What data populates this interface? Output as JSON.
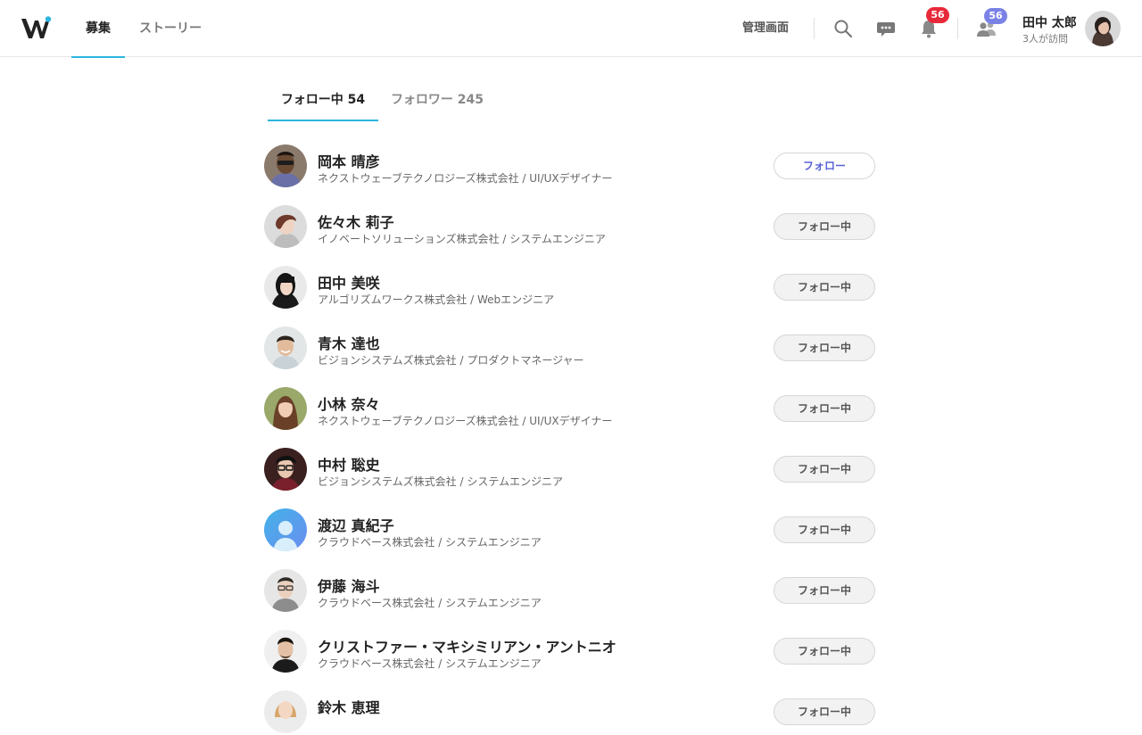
{
  "header": {
    "nav": [
      {
        "label": "募集",
        "active": true
      },
      {
        "label": "ストーリー",
        "active": false
      }
    ],
    "admin_label": "管理画面",
    "icons": [
      "search-icon",
      "chat-icon",
      "bell-icon",
      "people-icon"
    ],
    "notification_count": "56",
    "visitor_count": "56",
    "user_name": "田中 太郎",
    "user_visits": "3人が訪問",
    "colors": {
      "accent": "#2bb5e0",
      "notification_badge": "#e8293a",
      "visitor_badge": "#7b82e6"
    }
  },
  "follow_tabs": [
    {
      "label": "フォロー中 54",
      "active": true
    },
    {
      "label": "フォロワー 245",
      "active": false
    }
  ],
  "users": [
    {
      "name": "岡本 晴彦",
      "subtitle": "ネクストウェーブテクノロジーズ株式会社 / UI/UXデザイナー",
      "button": "フォロー",
      "following": false,
      "avatar": "photo"
    },
    {
      "name": "佐々木 莉子",
      "subtitle": "イノベートソリューションズ株式会社 / システムエンジニア",
      "button": "フォロー中",
      "following": true,
      "avatar": "photo"
    },
    {
      "name": "田中 美咲",
      "subtitle": "アルゴリズムワークス株式会社 / Webエンジニア",
      "button": "フォロー中",
      "following": true,
      "avatar": "photo"
    },
    {
      "name": "青木 達也",
      "subtitle": "ビジョンシステムズ株式会社 / プロダクトマネージャー",
      "button": "フォロー中",
      "following": true,
      "avatar": "photo"
    },
    {
      "name": "小林 奈々",
      "subtitle": "ネクストウェーブテクノロジーズ株式会社 / UI/UXデザイナー",
      "button": "フォロー中",
      "following": true,
      "avatar": "photo"
    },
    {
      "name": "中村 聡史",
      "subtitle": "ビジョンシステムズ株式会社 / システムエンジニア",
      "button": "フォロー中",
      "following": true,
      "avatar": "photo"
    },
    {
      "name": "渡辺 真紀子",
      "subtitle": "クラウドベース株式会社 / システムエンジニア",
      "button": "フォロー中",
      "following": true,
      "avatar": "default-user-icon"
    },
    {
      "name": "伊藤 海斗",
      "subtitle": "クラウドベース株式会社 / システムエンジニア",
      "button": "フォロー中",
      "following": true,
      "avatar": "photo"
    },
    {
      "name": "クリストファー・マキシミリアン・アントニオ",
      "subtitle": "クラウドベース株式会社 / システムエンジニア",
      "button": "フォロー中",
      "following": true,
      "avatar": "photo"
    },
    {
      "name": "鈴木 恵理",
      "subtitle": "",
      "button": "フォロー中",
      "following": true,
      "avatar": "photo"
    }
  ]
}
